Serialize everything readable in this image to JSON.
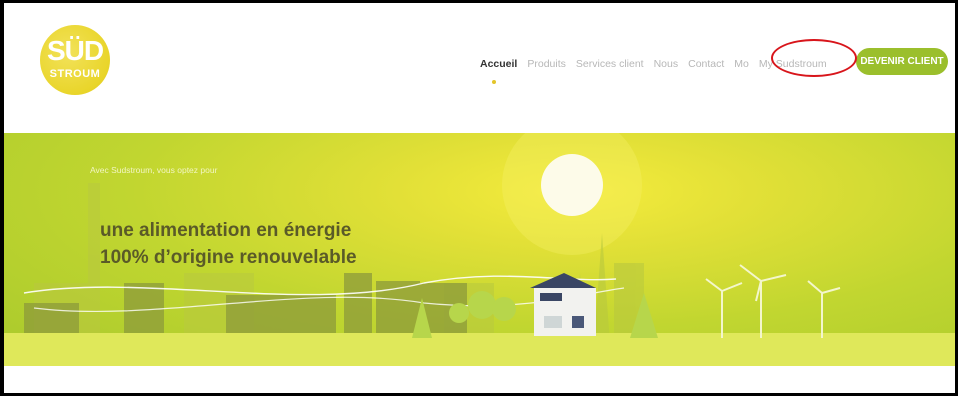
{
  "brand": {
    "logo_main": "SÜD",
    "logo_sub": "STROUM",
    "logo_color": "#e9d52a"
  },
  "nav": {
    "items": [
      "Accueil",
      "Produits",
      "Services client",
      "Nous",
      "Contact",
      "Mo",
      "My Sudstroum"
    ],
    "active": "Accueil",
    "cta": "DEVENIR CLIENT",
    "cta_color": "#9bbf2c"
  },
  "hero": {
    "intro": "Avec Sudstroum, vous optez pour",
    "headline_line1": "une alimentation en énergie",
    "headline_line2": "100% d’origine renouvelable"
  },
  "annotation": {
    "color": "#d8151b"
  }
}
